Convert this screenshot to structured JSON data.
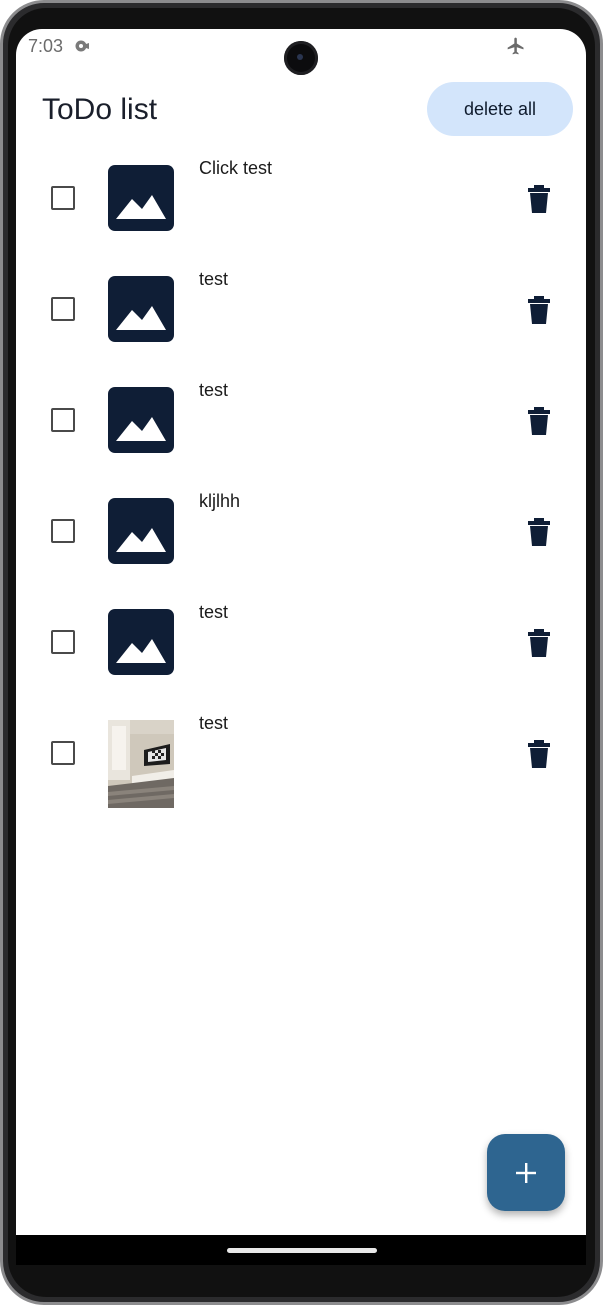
{
  "status_bar": {
    "time": "7:03",
    "notification_icon": "notification-icon",
    "airplane_icon": "airplane-icon"
  },
  "app": {
    "title": "ToDo list",
    "delete_all_label": "delete all"
  },
  "todos": [
    {
      "label": "Click test",
      "image": "placeholder-image-icon",
      "checked": false
    },
    {
      "label": "test",
      "image": "placeholder-image-icon",
      "checked": false
    },
    {
      "label": "test",
      "image": "placeholder-image-icon",
      "checked": false
    },
    {
      "label": "kljlhh",
      "image": "placeholder-image-icon",
      "checked": false
    },
    {
      "label": "test",
      "image": "placeholder-image-icon",
      "checked": false
    },
    {
      "label": "test",
      "image": "room-photo",
      "checked": false
    }
  ],
  "fab": {
    "icon": "plus-icon"
  },
  "colors": {
    "accent": "#2e6590",
    "button_bg": "#d3e5fb",
    "thumb_bg": "#0f1e36"
  }
}
